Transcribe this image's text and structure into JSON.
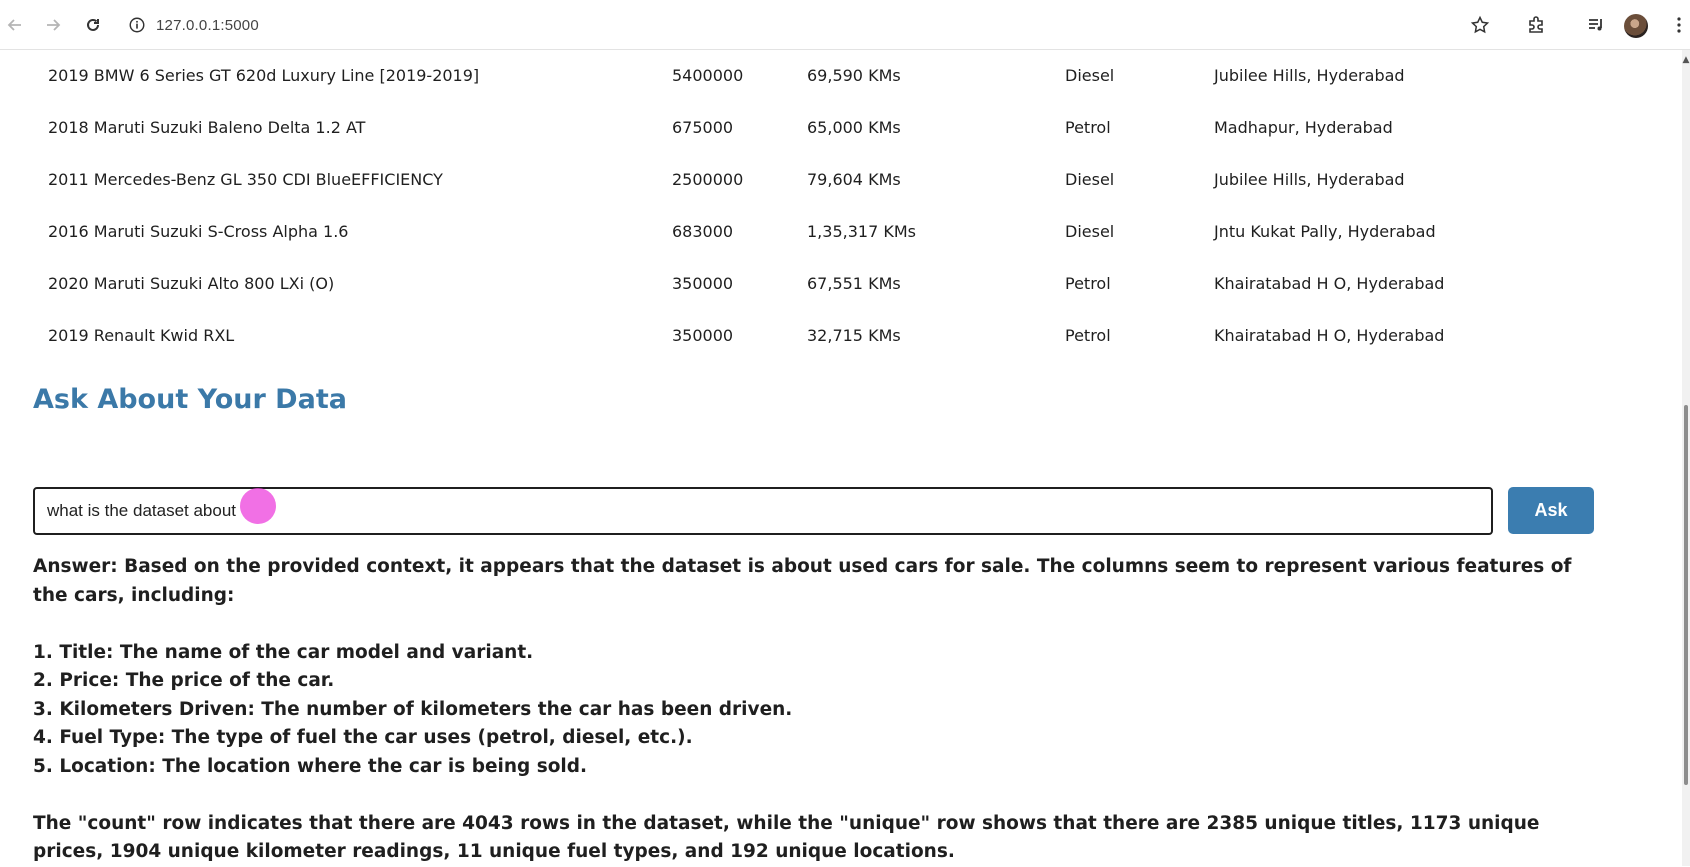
{
  "browser": {
    "url": "127.0.0.1:5000",
    "icons": [
      "back-arrow-icon",
      "forward-arrow-icon",
      "reload-icon",
      "site-info-icon",
      "star-icon",
      "extensions-icon",
      "media-control-icon",
      "profile-avatar"
    ]
  },
  "table": {
    "rows": [
      {
        "title": "2019 BMW 6 Series GT 620d Luxury Line [2019-2019]",
        "price": "5400000",
        "km": "69,590 KMs",
        "fuel": "Diesel",
        "location": "Jubilee Hills, Hyderabad"
      },
      {
        "title": "2018 Maruti Suzuki Baleno Delta 1.2 AT",
        "price": "675000",
        "km": "65,000 KMs",
        "fuel": "Petrol",
        "location": "Madhapur, Hyderabad"
      },
      {
        "title": "2011 Mercedes-Benz GL 350 CDI BlueEFFICIENCY",
        "price": "2500000",
        "km": "79,604 KMs",
        "fuel": "Diesel",
        "location": "Jubilee Hills, Hyderabad"
      },
      {
        "title": "2016 Maruti Suzuki S-Cross Alpha 1.6",
        "price": "683000",
        "km": "1,35,317 KMs",
        "fuel": "Diesel",
        "location": "Jntu Kukat Pally, Hyderabad"
      },
      {
        "title": "2020 Maruti Suzuki Alto 800 LXi (O)",
        "price": "350000",
        "km": "67,551 KMs",
        "fuel": "Petrol",
        "location": "Khairatabad H O, Hyderabad"
      },
      {
        "title": "2019 Renault Kwid RXL",
        "price": "350000",
        "km": "32,715 KMs",
        "fuel": "Petrol",
        "location": "Khairatabad H O, Hyderabad"
      }
    ]
  },
  "ask": {
    "heading": "Ask About Your Data",
    "input_value": "what is the dataset about",
    "button_label": "Ask"
  },
  "answer": {
    "intro": "Answer: Based on the provided context, it appears that the dataset is about used cars for sale. The columns seem to represent various features of the cars, including:",
    "items": [
      "1. Title: The name of the car model and variant.",
      "2. Price: The price of the car.",
      "3. Kilometers Driven: The number of kilometers the car has been driven.",
      "4. Fuel Type: The type of fuel the car uses (petrol, diesel, etc.).",
      "5. Location: The location where the car is being sold."
    ],
    "summary": "The \"count\" row indicates that there are 4043 rows in the dataset, while the \"unique\" row shows that there are 2385 unique titles, 1173 unique prices, 1904 unique kilometer readings, 11 unique fuel types, and 192 unique locations."
  },
  "colors": {
    "accent": "#3b79a8",
    "button": "#3b7db0",
    "cursor_highlight": "#ec40dc"
  }
}
